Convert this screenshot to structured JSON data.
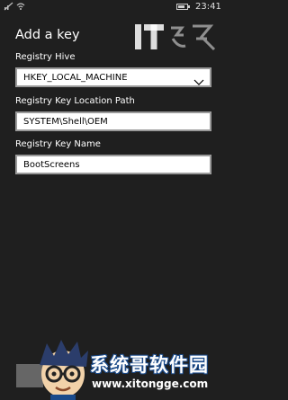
{
  "status_bar": {
    "time": "23:41",
    "battery_level": 0.8,
    "signal_icon": "signal-off-icon",
    "wifi_icon": "wifi-icon"
  },
  "watermark_top": {
    "text": "IT之家"
  },
  "page": {
    "title": "Add a key"
  },
  "fields": {
    "hive": {
      "label": "Registry Hive",
      "value": "HKEY_LOCAL_MACHINE"
    },
    "path": {
      "label": "Registry Key Location Path",
      "value": "SYSTEM\\Shell\\OEM"
    },
    "name": {
      "label": "Registry Key Name",
      "value": "BootScreens"
    }
  },
  "watermark_bottom": {
    "title": "系统哥软件园",
    "url": "www.xitongge.com"
  },
  "colors": {
    "background": "#1f1f1f",
    "field_background": "#ffffff",
    "field_border": "#9a9a9a",
    "watermark_blue": "#1a4a8a"
  }
}
